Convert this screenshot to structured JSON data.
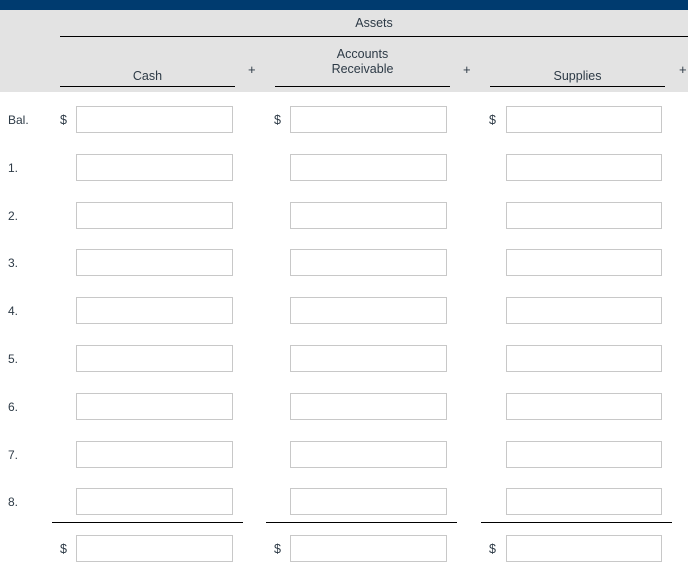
{
  "theme": {
    "topbar_color": "#003b6f",
    "header_band_color": "#e3e3e3",
    "text_color": "#2d3a46",
    "input_border_color": "#c8c8c8",
    "rule_color": "#000000",
    "page_background": "#ffffff"
  },
  "header": {
    "group_label": "Assets",
    "plus_signs": [
      "+",
      "+",
      "+"
    ],
    "columns": [
      {
        "label": "Cash",
        "lines": [
          "Cash"
        ]
      },
      {
        "label": "Accounts Receivable",
        "lines": [
          "Accounts",
          "Receivable"
        ]
      },
      {
        "label": "Supplies",
        "lines": [
          "Supplies"
        ]
      }
    ]
  },
  "table": {
    "currency_symbol": "$",
    "rows": [
      {
        "label": "Bal.",
        "show_dollar": true,
        "cells": [
          "",
          "",
          ""
        ]
      },
      {
        "label": "1.",
        "show_dollar": false,
        "cells": [
          "",
          "",
          ""
        ]
      },
      {
        "label": "2.",
        "show_dollar": false,
        "cells": [
          "",
          "",
          ""
        ]
      },
      {
        "label": "3.",
        "show_dollar": false,
        "cells": [
          "",
          "",
          ""
        ]
      },
      {
        "label": "4.",
        "show_dollar": false,
        "cells": [
          "",
          "",
          ""
        ]
      },
      {
        "label": "5.",
        "show_dollar": false,
        "cells": [
          "",
          "",
          ""
        ]
      },
      {
        "label": "6.",
        "show_dollar": false,
        "cells": [
          "",
          "",
          ""
        ]
      },
      {
        "label": "7.",
        "show_dollar": false,
        "cells": [
          "",
          "",
          ""
        ]
      },
      {
        "label": "8.",
        "show_dollar": false,
        "cells": [
          "",
          "",
          ""
        ]
      }
    ],
    "total_row": {
      "label": "",
      "show_dollar": true,
      "cells": [
        "",
        "",
        ""
      ]
    }
  }
}
